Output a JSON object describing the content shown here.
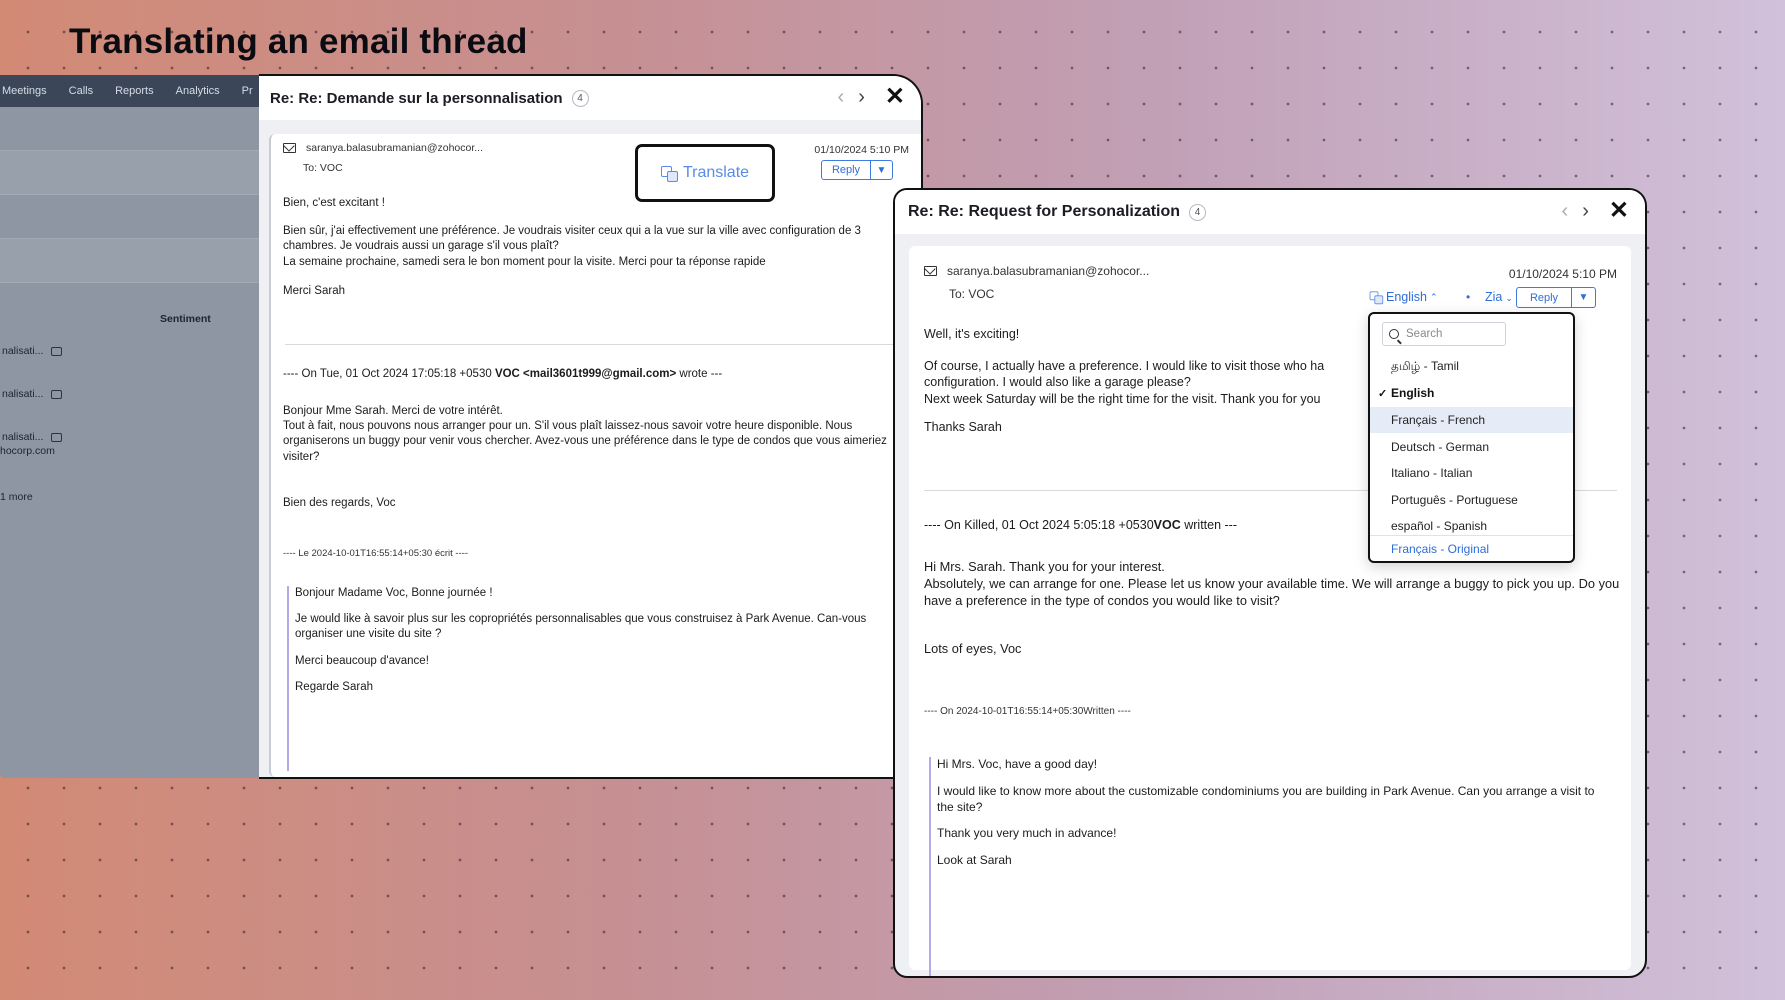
{
  "headline": "Translating an email thread",
  "crm": {
    "nav": [
      "Meetings",
      "Calls",
      "Reports",
      "Analytics",
      "Pr"
    ],
    "sentiment_label": "Sentiment",
    "rows": [
      {
        "label": "nalisati..."
      },
      {
        "label": "nalisati..."
      },
      {
        "label": "nalisati...",
        "sub": "hocorp.com"
      },
      {
        "label": "1 more"
      }
    ]
  },
  "left_window": {
    "title": "Re: Re: Demande sur la personnalisation",
    "count": "4",
    "sender": "saranya.balasubramanian@zohocor...",
    "to": "To: VOC",
    "date": "01/10/2024 5:10 PM",
    "translate_label": "Translate",
    "reply_label": "Reply",
    "body": [
      "Bien, c'est excitant !",
      "Bien sûr, j'ai effectivement une préférence. Je voudrais visiter ceux qui a la vue sur la ville avec configuration de 3 chambres. Je voudrais aussi un garage s'il vous plaît?",
      "La semaine prochaine, samedi sera le bon moment pour la visite. Merci pour ta réponse rapide",
      "Merci Sarah"
    ],
    "quoted_header_prefix": "---- On Tue, 01 Oct 2024 17:05:18 +0530",
    "quoted_header_sender": "VOC <mail3601t999@gmail.com>",
    "quoted_header_suffix": "wrote ---",
    "quoted_body": [
      "Bonjour Mme Sarah. Merci de votre intérêt.",
      "Tout à fait, nous pouvons nous arranger pour un. S'il vous plaît laissez-nous savoir votre heure disponible. Nous organiserons un buggy pour venir vous chercher. Avez-vous une préférence dans le type de condos que vous aimeriez visiter?",
      "Bien des regards, Voc"
    ],
    "second_sep": "---- Le 2024-10-01T16:55:14+05:30 écrit ----",
    "nested_quote": [
      "Bonjour Madame Voc, Bonne journée !",
      "Je would like à savoir plus sur les copropriétés personnalisables que vous construisez à Park Avenue. Can-vous organiser une visite du site ?",
      "Merci beaucoup d'avance!",
      "Regarde Sarah"
    ]
  },
  "right_window": {
    "title": "Re: Re: Request for Personalization",
    "count": "4",
    "sender": "saranya.balasubramanian@zohocor...",
    "to": "To: VOC",
    "date": "01/10/2024 5:10 PM",
    "language_label": "English",
    "zia_label": "Zia",
    "reply_label": "Reply",
    "body": [
      "Well, it's exciting!",
      "Of course, I actually have a preference. I would like to visit those who ha",
      "configuration. I would also like a garage please?",
      "Next week Saturday will be the right time for the visit. Thank you for you",
      "Thanks Sarah"
    ],
    "quoted_header_prefix": "---- On Killed, 01 Oct 2024 5:05:18 +0530",
    "quoted_header_sender": "VOC",
    "quoted_header_suffix": "written ---",
    "quoted_body": [
      "Hi Mrs. Sarah. Thank you for your interest.",
      "Absolutely, we can arrange for one. Please let us know your available time. We will arrange a buggy to pick you up. Do you have a preference in the type of condos you would like to visit?",
      "Lots of eyes, Voc"
    ],
    "second_sep": "---- On 2024-10-01T16:55:14+05:30Written ----",
    "nested_quote": [
      "Hi Mrs. Voc, have a good day!",
      "I would like to know more about the customizable condominiums you are building in Park Avenue. Can you arrange a visit to the site?",
      "Thank you very much in advance!",
      "Look at Sarah"
    ]
  },
  "language_dropdown": {
    "search_placeholder": "Search",
    "items": [
      {
        "label": "தமிழ் - Tamil",
        "state": "normal"
      },
      {
        "label": "English",
        "state": "selected"
      },
      {
        "label": "Français - French",
        "state": "hover"
      },
      {
        "label": "Deutsch - German",
        "state": "normal"
      },
      {
        "label": "Italiano - Italian",
        "state": "normal"
      },
      {
        "label": "Português - Portuguese",
        "state": "normal"
      },
      {
        "label": "español - Spanish",
        "state": "normal"
      }
    ],
    "original_label": "Français - Original"
  },
  "colors": {
    "accent_blue": "#2e6ed8",
    "quote_border": "#b7a8e6"
  }
}
